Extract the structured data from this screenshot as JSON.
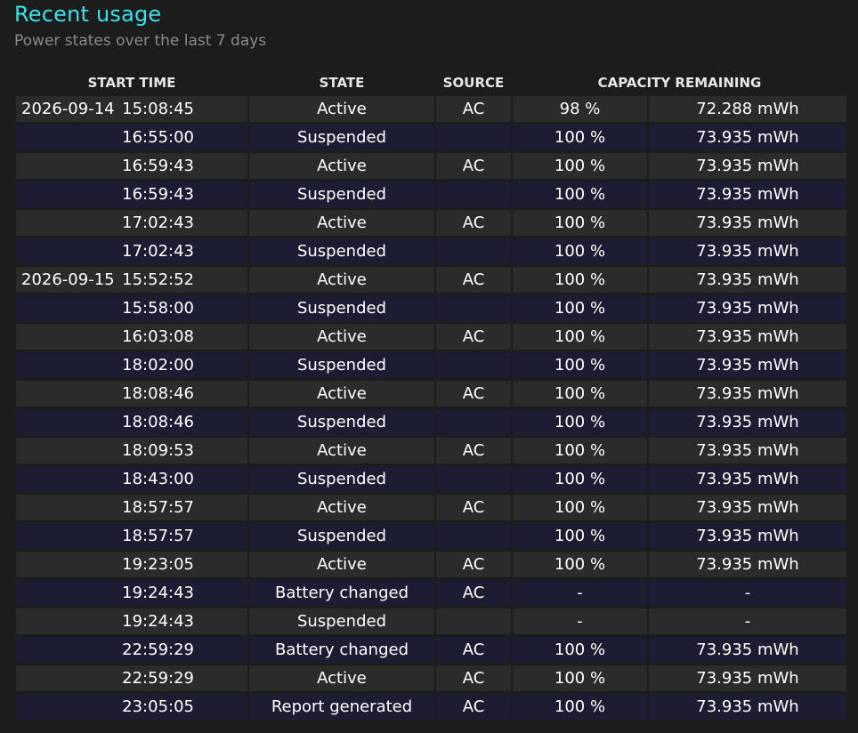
{
  "title": "Recent usage",
  "subtitle": "Power states over the last 7 days",
  "columns": {
    "start_time": "START TIME",
    "state": "STATE",
    "source": "SOURCE",
    "capacity": "CAPACITY REMAINING"
  },
  "rows": [
    {
      "date": "2026-09-14",
      "time": "15:08:45",
      "state": "Active",
      "source": "AC",
      "percent": "98 %",
      "capacity": "72.288 mWh"
    },
    {
      "date": "",
      "time": "16:55:00",
      "state": "Suspended",
      "source": "",
      "percent": "100 %",
      "capacity": "73.935 mWh"
    },
    {
      "date": "",
      "time": "16:59:43",
      "state": "Active",
      "source": "AC",
      "percent": "100 %",
      "capacity": "73.935 mWh"
    },
    {
      "date": "",
      "time": "16:59:43",
      "state": "Suspended",
      "source": "",
      "percent": "100 %",
      "capacity": "73.935 mWh"
    },
    {
      "date": "",
      "time": "17:02:43",
      "state": "Active",
      "source": "AC",
      "percent": "100 %",
      "capacity": "73.935 mWh"
    },
    {
      "date": "",
      "time": "17:02:43",
      "state": "Suspended",
      "source": "",
      "percent": "100 %",
      "capacity": "73.935 mWh"
    },
    {
      "date": "2026-09-15",
      "time": "15:52:52",
      "state": "Active",
      "source": "AC",
      "percent": "100 %",
      "capacity": "73.935 mWh"
    },
    {
      "date": "",
      "time": "15:58:00",
      "state": "Suspended",
      "source": "",
      "percent": "100 %",
      "capacity": "73.935 mWh"
    },
    {
      "date": "",
      "time": "16:03:08",
      "state": "Active",
      "source": "AC",
      "percent": "100 %",
      "capacity": "73.935 mWh"
    },
    {
      "date": "",
      "time": "18:02:00",
      "state": "Suspended",
      "source": "",
      "percent": "100 %",
      "capacity": "73.935 mWh"
    },
    {
      "date": "",
      "time": "18:08:46",
      "state": "Active",
      "source": "AC",
      "percent": "100 %",
      "capacity": "73.935 mWh"
    },
    {
      "date": "",
      "time": "18:08:46",
      "state": "Suspended",
      "source": "",
      "percent": "100 %",
      "capacity": "73.935 mWh"
    },
    {
      "date": "",
      "time": "18:09:53",
      "state": "Active",
      "source": "AC",
      "percent": "100 %",
      "capacity": "73.935 mWh"
    },
    {
      "date": "",
      "time": "18:43:00",
      "state": "Suspended",
      "source": "",
      "percent": "100 %",
      "capacity": "73.935 mWh"
    },
    {
      "date": "",
      "time": "18:57:57",
      "state": "Active",
      "source": "AC",
      "percent": "100 %",
      "capacity": "73.935 mWh"
    },
    {
      "date": "",
      "time": "18:57:57",
      "state": "Suspended",
      "source": "",
      "percent": "100 %",
      "capacity": "73.935 mWh"
    },
    {
      "date": "",
      "time": "19:23:05",
      "state": "Active",
      "source": "AC",
      "percent": "100 %",
      "capacity": "73.935 mWh"
    },
    {
      "date": "",
      "time": "19:24:43",
      "state": "Battery changed",
      "source": "AC",
      "percent": "-",
      "capacity": "-"
    },
    {
      "date": "",
      "time": "19:24:43",
      "state": "Suspended",
      "source": "",
      "percent": "-",
      "capacity": "-"
    },
    {
      "date": "",
      "time": "22:59:29",
      "state": "Battery changed",
      "source": "AC",
      "percent": "100 %",
      "capacity": "73.935 mWh"
    },
    {
      "date": "",
      "time": "22:59:29",
      "state": "Active",
      "source": "AC",
      "percent": "100 %",
      "capacity": "73.935 mWh"
    },
    {
      "date": "",
      "time": "23:05:05",
      "state": "Report generated",
      "source": "AC",
      "percent": "100 %",
      "capacity": "73.935 mWh"
    }
  ]
}
